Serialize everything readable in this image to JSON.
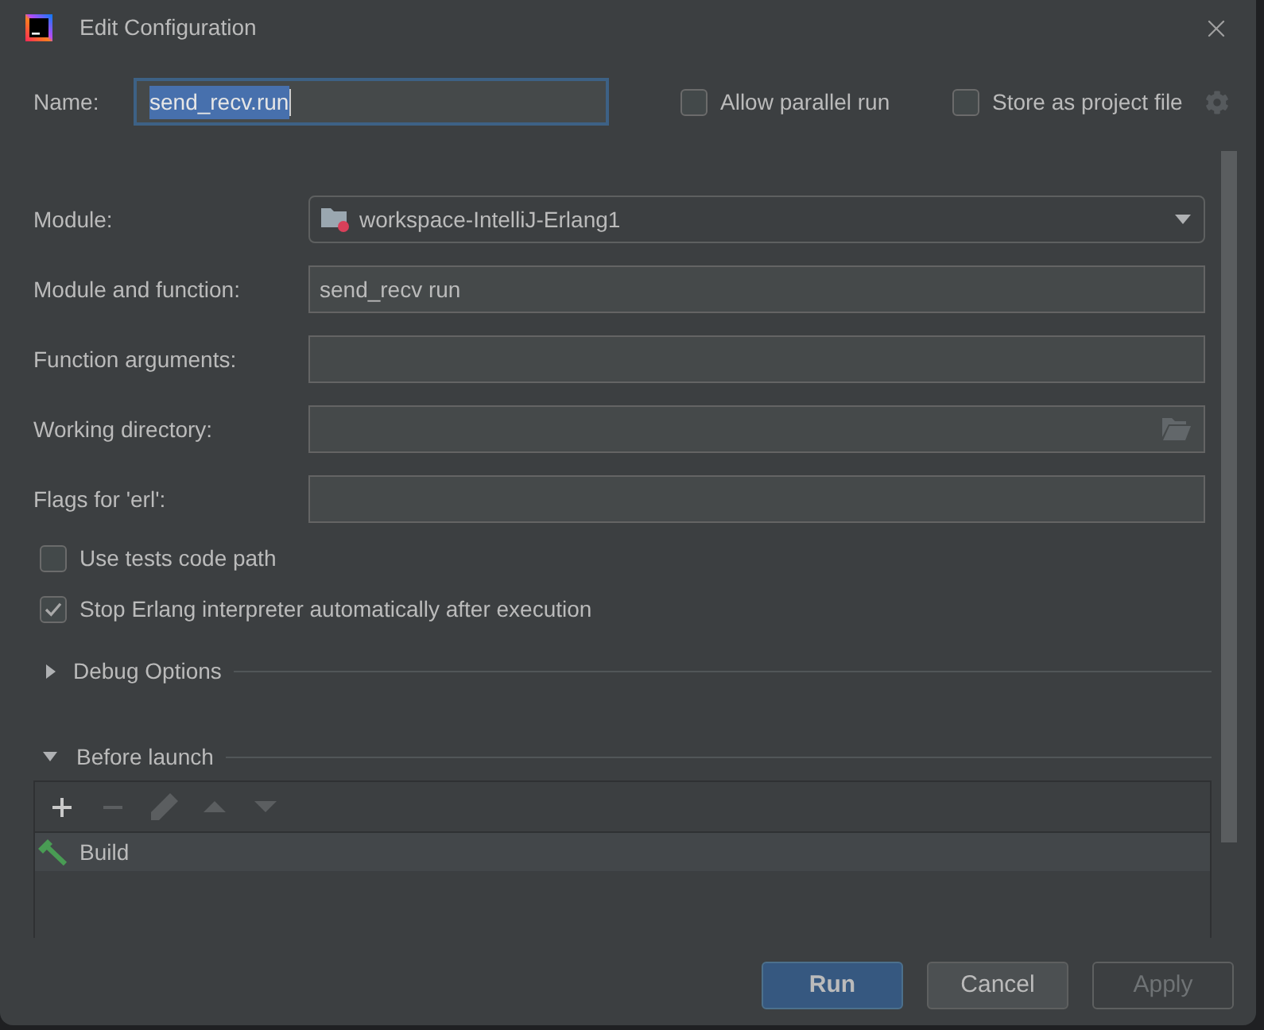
{
  "window": {
    "title": "Edit Configuration"
  },
  "name_field": {
    "label": "Name:",
    "value": "send_recv.run",
    "focused": true,
    "text_selected": true
  },
  "header_options": [
    {
      "label": "Allow parallel run",
      "checked": false
    },
    {
      "label": "Store as project file",
      "checked": false
    }
  ],
  "form_rows": [
    {
      "kind": "dropdown",
      "label": "Module:",
      "value": "workspace-IntelliJ-Erlang1"
    },
    {
      "kind": "text",
      "label": "Module and function:",
      "value": "send_recv run"
    },
    {
      "kind": "text",
      "label": "Function arguments:"
    },
    {
      "kind": "browse",
      "label": "Working directory:"
    },
    {
      "kind": "text",
      "label": "Flags for 'erl':"
    }
  ],
  "options": [
    {
      "label": "Use tests code path",
      "checked": false
    },
    {
      "label": "Stop Erlang interpreter automatically after execution",
      "checked": true
    }
  ],
  "debug_options": {
    "title": "Debug Options",
    "expanded": false
  },
  "before_launch": {
    "title": "Before launch",
    "expanded": true,
    "toolbar": [
      {
        "kind": "add",
        "disabled": false
      },
      {
        "kind": "remove",
        "disabled": true
      },
      {
        "kind": "edit",
        "disabled": true
      },
      {
        "kind": "up",
        "disabled": true
      },
      {
        "kind": "down",
        "disabled": true
      }
    ],
    "tasks": [
      {
        "label": "Build",
        "selected": true
      }
    ]
  },
  "buttons": [
    {
      "label": "Run",
      "kind": "primary",
      "disabled": false
    },
    {
      "label": "Cancel",
      "kind": "default",
      "disabled": false
    },
    {
      "label": "Apply",
      "kind": "default",
      "disabled": true
    }
  ]
}
